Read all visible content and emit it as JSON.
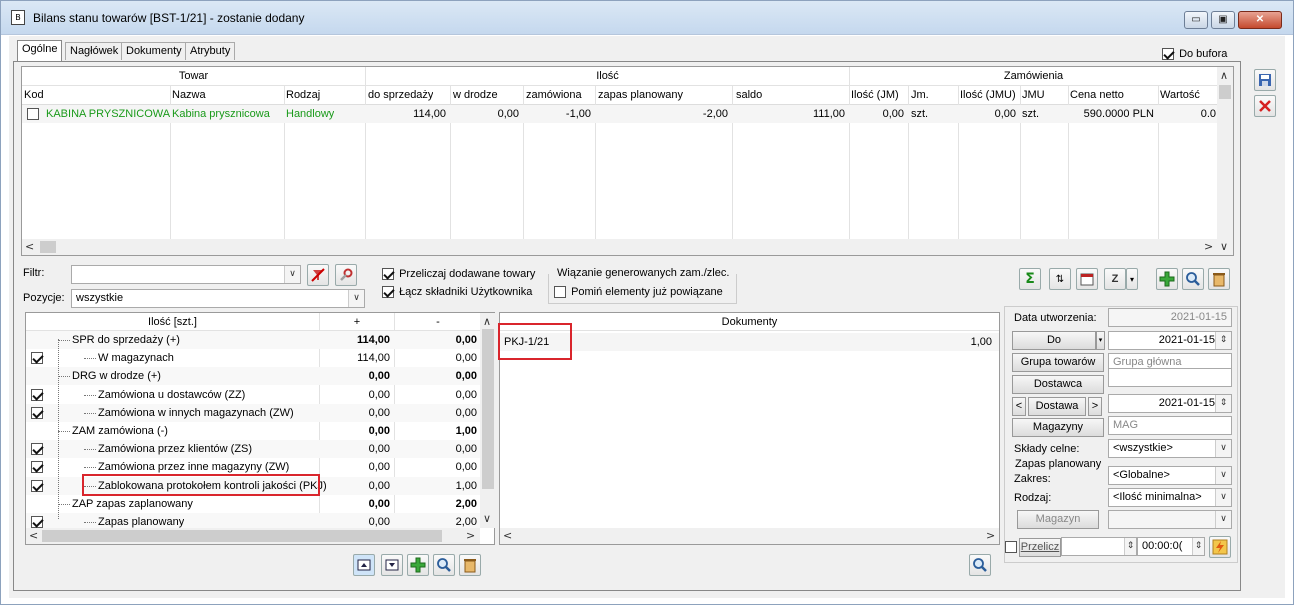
{
  "window": {
    "title": "Bilans stanu towarów [BST-1/21] - zostanie dodany",
    "min": "▭",
    "max": "▣",
    "close": "✕"
  },
  "tabs": [
    "Ogólne",
    "Nagłówek",
    "Dokumenty",
    "Atrybuty"
  ],
  "do_bufora": "Do bufora",
  "top_grid": {
    "groups": [
      "Towar",
      "Ilość",
      "Zamówienia"
    ],
    "columns": [
      "Kod",
      "Nazwa",
      "Rodzaj",
      "do sprzedaży",
      "w drodze",
      "zamówiona",
      "zapas planowany",
      "saldo",
      "Ilość (JM)",
      "Jm.",
      "Ilość (JMU)",
      "JMU",
      "Cena netto",
      "Wartość"
    ],
    "row": [
      "KABINA PRYSZNICOWA",
      "Kabina prysznicowa",
      "Handlowy",
      "114,00",
      "0,00",
      "-1,00",
      "-2,00",
      "111,00",
      "0,00",
      "szt.",
      "0,00",
      "szt.",
      "590.0000 PLN",
      "0.0"
    ]
  },
  "filter": {
    "label": "Filtr:",
    "value": ""
  },
  "pozycje": {
    "label": "Pozycje:",
    "value": "wszystkie"
  },
  "options": {
    "przeliczaj": "Przeliczaj dodawane towary",
    "lacz": "Łącz składniki Użytkownika",
    "group_title": "Wiązanie generowanych zam./zlec.",
    "pomin": "Pomiń elementy już powiązane"
  },
  "qty_grid": {
    "headers": [
      "Ilość [szt.]",
      "+",
      "-"
    ],
    "rows": [
      {
        "label": "SPR do sprzedaży (+)",
        "plus": "114,00",
        "minus": "0,00",
        "bold": true,
        "checked": false,
        "indent": 0
      },
      {
        "label": "W magazynach",
        "plus": "114,00",
        "minus": "0,00",
        "bold": false,
        "checked": true,
        "indent": 1
      },
      {
        "label": "DRG w drodze (+)",
        "plus": "0,00",
        "minus": "0,00",
        "bold": true,
        "checked": false,
        "indent": 0
      },
      {
        "label": "Zamówiona u dostawców (ZZ)",
        "plus": "0,00",
        "minus": "0,00",
        "bold": false,
        "checked": true,
        "indent": 1
      },
      {
        "label": "Zamówiona w innych magazynach (ZW)",
        "plus": "0,00",
        "minus": "0,00",
        "bold": false,
        "checked": true,
        "indent": 1
      },
      {
        "label": "ZAM zamówiona (-)",
        "plus": "0,00",
        "minus": "1,00",
        "bold": true,
        "checked": false,
        "indent": 0
      },
      {
        "label": "Zamówiona przez klientów (ZS)",
        "plus": "0,00",
        "minus": "0,00",
        "bold": false,
        "checked": true,
        "indent": 1
      },
      {
        "label": "Zamówiona przez inne magazyny (ZW)",
        "plus": "0,00",
        "minus": "0,00",
        "bold": false,
        "checked": true,
        "indent": 1
      },
      {
        "label": "Zablokowana protokołem kontroli jakości (PKJ)",
        "plus": "0,00",
        "minus": "1,00",
        "bold": false,
        "checked": true,
        "indent": 1
      },
      {
        "label": "ZAP zapas zaplanowany",
        "plus": "0,00",
        "minus": "2,00",
        "bold": true,
        "checked": false,
        "indent": 0
      },
      {
        "label": "Zapas planowany",
        "plus": "0,00",
        "minus": "2,00",
        "bold": false,
        "checked": true,
        "indent": 1
      }
    ]
  },
  "docs_grid": {
    "header": "Dokumenty",
    "rows": [
      {
        "doc": "PKJ-1/21",
        "val": "1,00"
      }
    ]
  },
  "right_panel": {
    "data_utw_label": "Data utworzenia:",
    "data_utw": "2021-01-15",
    "do_label": "Do",
    "do_date": "2021-01-15",
    "grupa_btn": "Grupa towarów",
    "grupa_val": "Grupa główna",
    "dostawca_btn": "Dostawca",
    "dostawca_val": "",
    "dostawa_btn": "Dostawa",
    "dostawa_date": "2021-01-15",
    "magazyny_btn": "Magazyny",
    "magazyny_val": "MAG",
    "sklady_label": "Składy celne:",
    "sklady_val": "<wszystkie>",
    "zapas_title": "Zapas planowany",
    "zakres_label": "Zakres:",
    "zakres_val": "<Globalne>",
    "rodzaj_label": "Rodzaj:",
    "rodzaj_val": "<Ilość minimalna>",
    "magazyn_btn": "Magazyn",
    "magazyn_val": "",
    "przelicz": "Przelicz",
    "time": "00:00:0("
  }
}
